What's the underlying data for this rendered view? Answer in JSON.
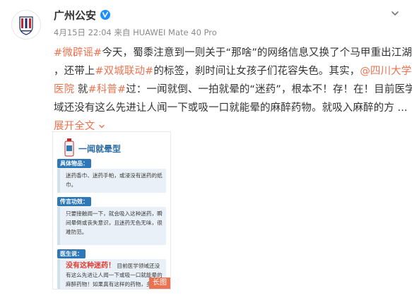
{
  "post": {
    "author": "广州公安",
    "date": "4月15日 22:04",
    "source_prefix": "来自",
    "device": "HUAWEI Mate 40 Pro",
    "lines": [
      [
        {
          "t": "#微辟谣#",
          "tag": true
        },
        {
          "t": "今天，蜀黍注意到一则关于“那啥”的网络信息又换了个马甲重出江湖"
        }
      ],
      [
        {
          "t": "，还带上"
        },
        {
          "t": "#双城联动#",
          "tag": true
        },
        {
          "t": "的标签，刹时间让女孩子们花容失色。其实，"
        },
        {
          "t": "@四川大学华西",
          "tag": true
        }
      ],
      [
        {
          "t": "医院",
          "tag": true
        },
        {
          "t": " 就"
        },
        {
          "t": "#科普#",
          "tag": true
        },
        {
          "t": "过：一闻就倒、一拍就晕的“迷药”，根本不！存！在！目前医学领"
        }
      ],
      [
        {
          "t": "域还没有这么先进让人闻一下或吸一口就能晕的麻醉药物。就吸入麻醉的方 ..."
        }
      ]
    ],
    "expand_label": "展开全文",
    "expand_icon": "chevron-down"
  },
  "card": {
    "title": "一闻就晕型",
    "sections": [
      {
        "label": "具体物品：",
        "text": "迷药香巾、迷药手帕，或浸没有迷药的纸巾。"
      },
      {
        "label": "传言功效：",
        "text": "只要接触闻一下，就会吸入这种迷药，瞬间晕倒或丧失意识，且迷药无色无味，很难防范。"
      },
      {
        "label": "医生说：",
        "claim": "没有这种迷药！",
        "text": "目前医学领域还没有这么先进让人闻一下或吸一口就能晕的麻醉药物！如果真有这样的药物，多半可以申请诺贝尔医学奖了。"
      }
    ],
    "badge": "长图"
  },
  "colors": {
    "link": "#eb7350",
    "card_accent": "#2f78b7",
    "claim": "#e03c31"
  }
}
